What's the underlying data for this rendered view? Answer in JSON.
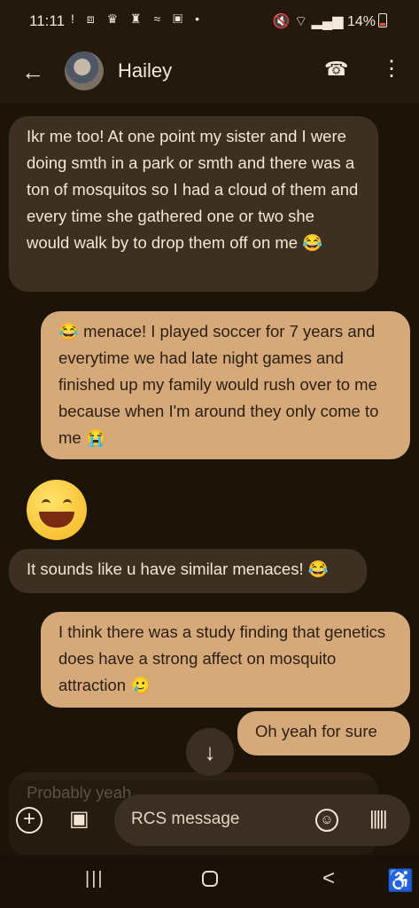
{
  "status": {
    "time": "11:11",
    "battery_text": "14%",
    "icons": [
      "!",
      "cube-icon",
      "crown-icon",
      "chess-icon",
      "wifi-icon",
      "gallery-icon",
      "dot-icon"
    ]
  },
  "header": {
    "name": "Hailey",
    "back_icon": "back-arrow-icon",
    "phone_icon": "phone-icon",
    "more_icon": "more-vert-icon"
  },
  "messages": [
    {
      "type": "incoming",
      "text": "Ikr me too! At one point my sister and I were doing smth in a park or smth and there was a ton of mosquitos so I had a cloud of them and every time she gathered one or two she would walk by to drop them off on me 😂"
    },
    {
      "type": "outgoing",
      "text": "😂 menace! I played soccer for 7 years and everytime we had late night games and finished up my family would rush over to me because when I'm around they only come to me 😭"
    },
    {
      "type": "incoming-emoji",
      "text": "😂"
    },
    {
      "type": "incoming",
      "text": "It sounds like u have similar menaces! 😂"
    },
    {
      "type": "outgoing",
      "text": "I think there was a study finding that genetics does have a strong affect on mosquito attraction 🥲"
    },
    {
      "type": "outgoing",
      "text": "Oh yeah for sure"
    },
    {
      "type": "incoming-partial",
      "text": "Probably yeah"
    }
  ],
  "composer": {
    "placeholder": "RCS message"
  },
  "nav": {
    "recent_icon": "|||",
    "home_icon": "home-icon",
    "back_icon": "<",
    "accessibility_icon": "accessibility-icon"
  }
}
